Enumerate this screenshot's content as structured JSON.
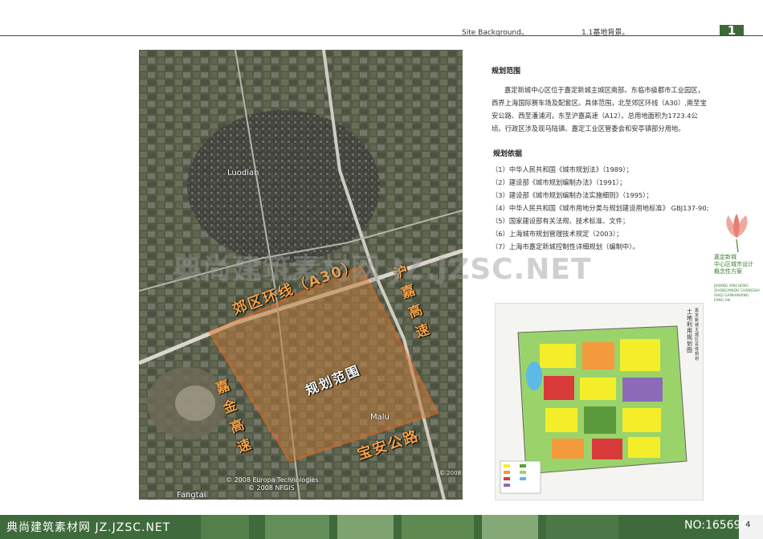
{
  "header": {
    "subtitle": "Site Background。",
    "title": "1.1基地背景。",
    "page_badge": "1"
  },
  "satellite": {
    "ring_road_label": "郊区环线（A30）",
    "scope_label": "规划范围",
    "hujia_label": [
      "沪",
      "嘉",
      "高",
      "速"
    ],
    "jiajin_label": [
      "嘉",
      "金",
      "高",
      "速"
    ],
    "baoan_label": "宝安公路",
    "place_luodian": "Luodian",
    "place_malu": "Malu",
    "place_fangtai": "Fangtai",
    "credit_1": "© 2008 Europa Technologies",
    "credit_2": "© 2008 NFGIS",
    "credit_year": "© 2008",
    "colors": {
      "boundary": "#ff6a1a",
      "label": "#f3a34a"
    }
  },
  "scope": {
    "title": "规划范围",
    "text": "嘉定新城中心区位于嘉定新城主城区南部。东临市级都市工业园区，西界上海国际赛车场及配套区。具体范围，北至郊区环线（A30）,南至宝安公路、西至潘浦河，东至沪嘉高速（A12）。总用地面积为1723.4公顷。行政区涉及现马陆镇、嘉定工业区管委会和安亭镇部分用地。"
  },
  "basis": {
    "title": "规划依据",
    "items": [
      "（1）中华人民共和国《城市规划法》（1989）；",
      "（2）建设部《城市规划编制办法》（1991）；",
      "（3）建设部《城市规划编制办法实施细则》（1995）；",
      "（4）中华人民共和国《城市用地分类与规划建设用地标准》 GBJ137-90;",
      "（5）国家建设部有关法规、技术标准、文件；",
      "（6）上海城市规划管理技术规定（2003）；",
      "（7）上海市嘉定新城控制性详细规划（编制中）。"
    ]
  },
  "side_panel": {
    "title_lines": [
      "嘉定新城",
      "中心区城市设计",
      "概念性方案"
    ],
    "pinyin_lines": [
      "JIADING XINCHENG",
      "ZHONGXINQU CHENGSHI",
      "SHEJI GAINIANXING",
      "FANG AN"
    ]
  },
  "landuse_map": {
    "vertical_title_1": "嘉定新城主城区总体规划",
    "vertical_title_2": "土地利用规划图"
  },
  "watermark": "典尚建筑素材网 JZ.JZSC.NET",
  "footer": {
    "left_text": "典尚建筑素材网 JZ.JZSC.NET",
    "right_text": "NO:165694",
    "page_number": "4",
    "colors": {
      "bar": "#3f6b3c",
      "bar_light": "#7ea36f"
    }
  }
}
